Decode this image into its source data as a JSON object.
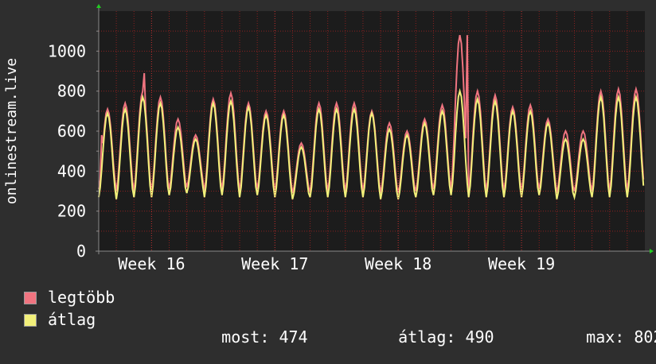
{
  "colors": {
    "background": "#2e2e2e",
    "plot_background": "#1c1c1c",
    "grid": "#8a2020",
    "axis": "#8a8a8a",
    "arrow": "#22cc22",
    "text": "#ffffff",
    "max_line": "#f07480",
    "avg_line": "#f2f07a"
  },
  "legend": {
    "items": [
      {
        "label": "legtöbb",
        "color": "#f07480"
      },
      {
        "label": "átlag",
        "color": "#f2f07a"
      }
    ],
    "stats": {
      "now_label": "most:",
      "now_value": "474",
      "avg_label": "átlag:",
      "avg_value": "490",
      "max_label": "max:",
      "max_value": "802"
    }
  },
  "chart_data": {
    "type": "line",
    "ylabel": "onlinestream.live",
    "xlabel": "",
    "title": "",
    "ylim": [
      0,
      1200
    ],
    "yticks": [
      0,
      200,
      400,
      600,
      800,
      1000
    ],
    "x_tick_labels": [
      "Week 16",
      "Week 17",
      "Week 18",
      "Week 19"
    ],
    "grid": true,
    "days": 31,
    "series": [
      {
        "name": "legtöbb",
        "color": "#f07480",
        "daily_peak": [
          710,
          740,
          800,
          770,
          660,
          580,
          760,
          790,
          740,
          700,
          700,
          540,
          740,
          740,
          740,
          700,
          640,
          600,
          660,
          730,
          1080,
          800,
          780,
          720,
          730,
          660,
          600,
          600,
          800,
          810,
          810
        ],
        "daily_trough": [
          310,
          300,
          300,
          300,
          310,
          320,
          300,
          310,
          300,
          310,
          300,
          290,
          300,
          300,
          300,
          300,
          290,
          290,
          300,
          310,
          310,
          300,
          300,
          300,
          300,
          310,
          290,
          300,
          300,
          300,
          300
        ],
        "spikes": [
          {
            "day": 2.55,
            "value": 890
          },
          {
            "day": 20.9,
            "value": 1080
          },
          {
            "day": 0.2,
            "value": 580
          }
        ]
      },
      {
        "name": "átlag",
        "color": "#f2f07a",
        "daily_peak": [
          690,
          710,
          770,
          740,
          620,
          560,
          740,
          750,
          720,
          680,
          680,
          520,
          710,
          710,
          710,
          690,
          610,
          580,
          640,
          700,
          800,
          760,
          750,
          700,
          700,
          640,
          560,
          560,
          770,
          770,
          770
        ],
        "daily_trough": [
          270,
          260,
          270,
          270,
          280,
          290,
          270,
          280,
          270,
          280,
          270,
          260,
          270,
          270,
          270,
          270,
          260,
          260,
          270,
          280,
          280,
          270,
          270,
          270,
          270,
          280,
          260,
          270,
          270,
          270,
          270
        ],
        "end_value": 474
      }
    ]
  }
}
